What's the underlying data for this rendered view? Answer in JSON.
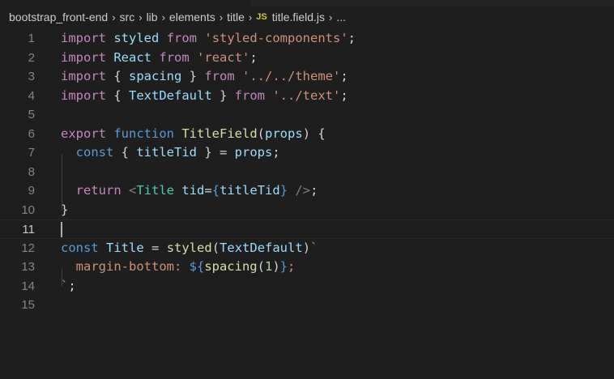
{
  "breadcrumb": {
    "items": [
      "bootstrap_front-end",
      "src",
      "lib",
      "elements",
      "title"
    ],
    "file_badge": "JS",
    "file": "title.field.js",
    "more": "..."
  },
  "editor": {
    "active_line": 11,
    "line_numbers": [
      "1",
      "2",
      "3",
      "4",
      "5",
      "6",
      "7",
      "8",
      "9",
      "10",
      "11",
      "12",
      "13",
      "14",
      "15"
    ],
    "lines": [
      {
        "tokens": [
          {
            "t": "import",
            "c": "kw"
          },
          {
            "t": " "
          },
          {
            "t": "styled",
            "c": "var"
          },
          {
            "t": " "
          },
          {
            "t": "from",
            "c": "kw"
          },
          {
            "t": " "
          },
          {
            "t": "'styled-components'",
            "c": "str"
          },
          {
            "t": ";"
          }
        ]
      },
      {
        "tokens": [
          {
            "t": "import",
            "c": "kw"
          },
          {
            "t": " "
          },
          {
            "t": "React",
            "c": "var"
          },
          {
            "t": " "
          },
          {
            "t": "from",
            "c": "kw"
          },
          {
            "t": " "
          },
          {
            "t": "'react'",
            "c": "str"
          },
          {
            "t": ";"
          }
        ]
      },
      {
        "tokens": [
          {
            "t": "import",
            "c": "kw"
          },
          {
            "t": " { "
          },
          {
            "t": "spacing",
            "c": "var"
          },
          {
            "t": " } "
          },
          {
            "t": "from",
            "c": "kw"
          },
          {
            "t": " "
          },
          {
            "t": "'../../theme'",
            "c": "str"
          },
          {
            "t": ";"
          }
        ]
      },
      {
        "tokens": [
          {
            "t": "import",
            "c": "kw"
          },
          {
            "t": " { "
          },
          {
            "t": "TextDefault",
            "c": "var"
          },
          {
            "t": " } "
          },
          {
            "t": "from",
            "c": "kw"
          },
          {
            "t": " "
          },
          {
            "t": "'../text'",
            "c": "str"
          },
          {
            "t": ";"
          }
        ]
      },
      {
        "tokens": []
      },
      {
        "tokens": [
          {
            "t": "export",
            "c": "kw"
          },
          {
            "t": " "
          },
          {
            "t": "function",
            "c": "st"
          },
          {
            "t": " "
          },
          {
            "t": "TitleField",
            "c": "fn"
          },
          {
            "t": "("
          },
          {
            "t": "props",
            "c": "var"
          },
          {
            "t": ") {"
          }
        ]
      },
      {
        "tokens": [
          {
            "t": "  "
          },
          {
            "t": "const",
            "c": "st"
          },
          {
            "t": " { "
          },
          {
            "t": "titleTid",
            "c": "var"
          },
          {
            "t": " } = "
          },
          {
            "t": "props",
            "c": "var"
          },
          {
            "t": ";"
          }
        ]
      },
      {
        "tokens": []
      },
      {
        "tokens": [
          {
            "t": "  "
          },
          {
            "t": "return",
            "c": "kw"
          },
          {
            "t": " "
          },
          {
            "t": "<",
            "c": "tag"
          },
          {
            "t": "Title",
            "c": "cls"
          },
          {
            "t": " "
          },
          {
            "t": "tid",
            "c": "var"
          },
          {
            "t": "="
          },
          {
            "t": "{",
            "c": "st"
          },
          {
            "t": "titleTid",
            "c": "var"
          },
          {
            "t": "}",
            "c": "st"
          },
          {
            "t": " "
          },
          {
            "t": "/>",
            "c": "tag"
          },
          {
            "t": ";"
          }
        ]
      },
      {
        "tokens": [
          {
            "t": "}"
          }
        ]
      },
      {
        "tokens": []
      },
      {
        "tokens": [
          {
            "t": "const",
            "c": "st"
          },
          {
            "t": " "
          },
          {
            "t": "Title",
            "c": "var"
          },
          {
            "t": " = "
          },
          {
            "t": "styled",
            "c": "fn"
          },
          {
            "t": "("
          },
          {
            "t": "TextDefault",
            "c": "var"
          },
          {
            "t": ")"
          },
          {
            "t": "`",
            "c": "str"
          }
        ]
      },
      {
        "tokens": [
          {
            "t": "  margin-bottom: ",
            "c": "str"
          },
          {
            "t": "${",
            "c": "st"
          },
          {
            "t": "spacing",
            "c": "fn"
          },
          {
            "t": "("
          },
          {
            "t": "1",
            "c": "num"
          },
          {
            "t": ")"
          },
          {
            "t": "}",
            "c": "st"
          },
          {
            "t": ";",
            "c": "str"
          }
        ]
      },
      {
        "tokens": [
          {
            "t": "`",
            "c": "str"
          },
          {
            "t": ";"
          }
        ]
      },
      {
        "tokens": []
      }
    ]
  }
}
